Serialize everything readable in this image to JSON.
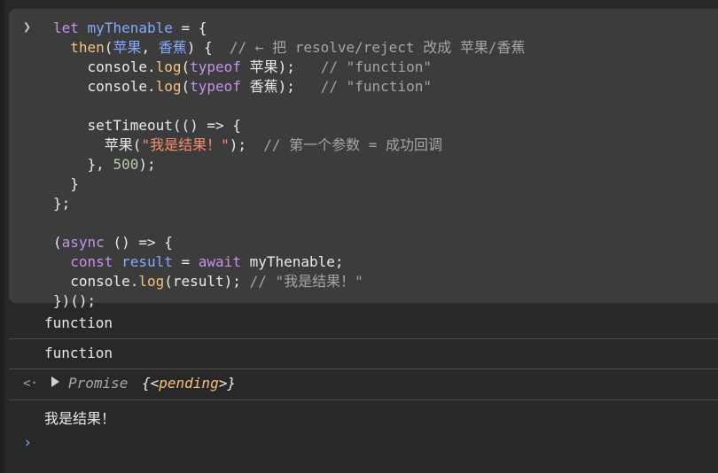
{
  "input": {
    "prompt_glyph": "❯",
    "lines": [
      [
        {
          "t": "let",
          "c": "kw"
        },
        {
          "t": " "
        },
        {
          "t": "myThenable",
          "c": "var"
        },
        {
          "t": " = {"
        }
      ],
      [
        {
          "t": "  "
        },
        {
          "t": "then",
          "c": "fn"
        },
        {
          "t": "("
        },
        {
          "t": "苹果",
          "c": "var"
        },
        {
          "t": ", "
        },
        {
          "t": "香蕉",
          "c": "var"
        },
        {
          "t": ") {  "
        },
        {
          "t": "// ← 把 resolve/reject 改成 苹果/香蕉",
          "c": "cmt"
        }
      ],
      [
        {
          "t": "    console."
        },
        {
          "t": "log",
          "c": "fn"
        },
        {
          "t": "("
        },
        {
          "t": "typeof",
          "c": "kw"
        },
        {
          "t": " 苹果);   "
        },
        {
          "t": "// \"function\"",
          "c": "cmt"
        }
      ],
      [
        {
          "t": "    console."
        },
        {
          "t": "log",
          "c": "fn"
        },
        {
          "t": "("
        },
        {
          "t": "typeof",
          "c": "kw"
        },
        {
          "t": " 香蕉);   "
        },
        {
          "t": "// \"function\"",
          "c": "cmt"
        }
      ],
      [
        {
          "t": ""
        }
      ],
      [
        {
          "t": "    setTimeout(() => {"
        }
      ],
      [
        {
          "t": "      苹果("
        },
        {
          "t": "\"我是结果！\"",
          "c": "str"
        },
        {
          "t": ");  "
        },
        {
          "t": "// 第一个参数 = 成功回调",
          "c": "cmt"
        }
      ],
      [
        {
          "t": "    }, "
        },
        {
          "t": "500",
          "c": "num"
        },
        {
          "t": ");"
        }
      ],
      [
        {
          "t": "  }"
        }
      ],
      [
        {
          "t": "};"
        }
      ],
      [
        {
          "t": ""
        }
      ],
      [
        {
          "t": "("
        },
        {
          "t": "async",
          "c": "kw"
        },
        {
          "t": " () => {"
        }
      ],
      [
        {
          "t": "  "
        },
        {
          "t": "const",
          "c": "kw"
        },
        {
          "t": " "
        },
        {
          "t": "result",
          "c": "var"
        },
        {
          "t": " = "
        },
        {
          "t": "await",
          "c": "kw"
        },
        {
          "t": " myThenable;"
        }
      ],
      [
        {
          "t": "  console."
        },
        {
          "t": "log",
          "c": "fn"
        },
        {
          "t": "(result); "
        },
        {
          "t": "// \"我是结果！\"",
          "c": "cmt"
        }
      ],
      [
        {
          "t": "})();"
        }
      ]
    ]
  },
  "output": {
    "log1": "function",
    "log2": "function",
    "return_glyph": "<·",
    "promise_label": "Promise",
    "promise_state_open": "{<",
    "promise_state": "pending",
    "promise_state_close": ">}",
    "log3": "我是结果！"
  },
  "bottom": {
    "prompt_glyph": "›"
  },
  "colors": {
    "background": "#282828",
    "input_block": "#3c3c3c",
    "keyword": "#c792ea",
    "function": "#f6c37a",
    "variable": "#82aaff",
    "string": "#f78c6c",
    "number": "#b5cea8",
    "comment": "#a5a5a5"
  }
}
